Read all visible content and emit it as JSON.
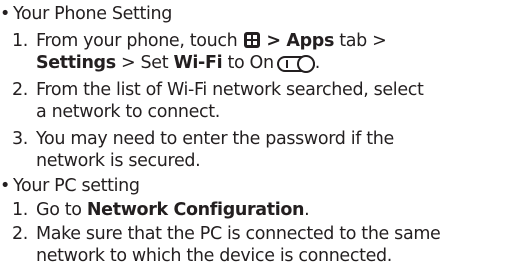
{
  "sections": [
    {
      "bullet": "•",
      "title": "Your Phone Setting",
      "steps": [
        {
          "num": "1.",
          "line1": {
            "t1": "From your phone, touch",
            "t2": " > Apps",
            "t3": " tab >"
          },
          "line2": {
            "b1": "Settings",
            "t2": " > Set ",
            "b2": "Wi-Fi",
            "t3": " to On",
            "t4": "."
          }
        },
        {
          "num": "2.",
          "line1": "From the list of Wi-Fi network searched, select",
          "line2": "a network to connect."
        },
        {
          "num": "3.",
          "line1": "You may need to enter the password if the",
          "line2": "network is secured."
        }
      ]
    },
    {
      "bullet": "•",
      "title": "Your PC setting",
      "steps": [
        {
          "num": "1.",
          "t1": "Go to ",
          "b1": "Network Configuration",
          "t2": "."
        },
        {
          "num": "2.",
          "line1": "Make sure that the PC is connected to the same",
          "line2": "network to which the device is connected."
        }
      ]
    }
  ],
  "icons": {
    "apps": "apps-grid-icon",
    "toggle": "toggle-switch-on-icon"
  }
}
